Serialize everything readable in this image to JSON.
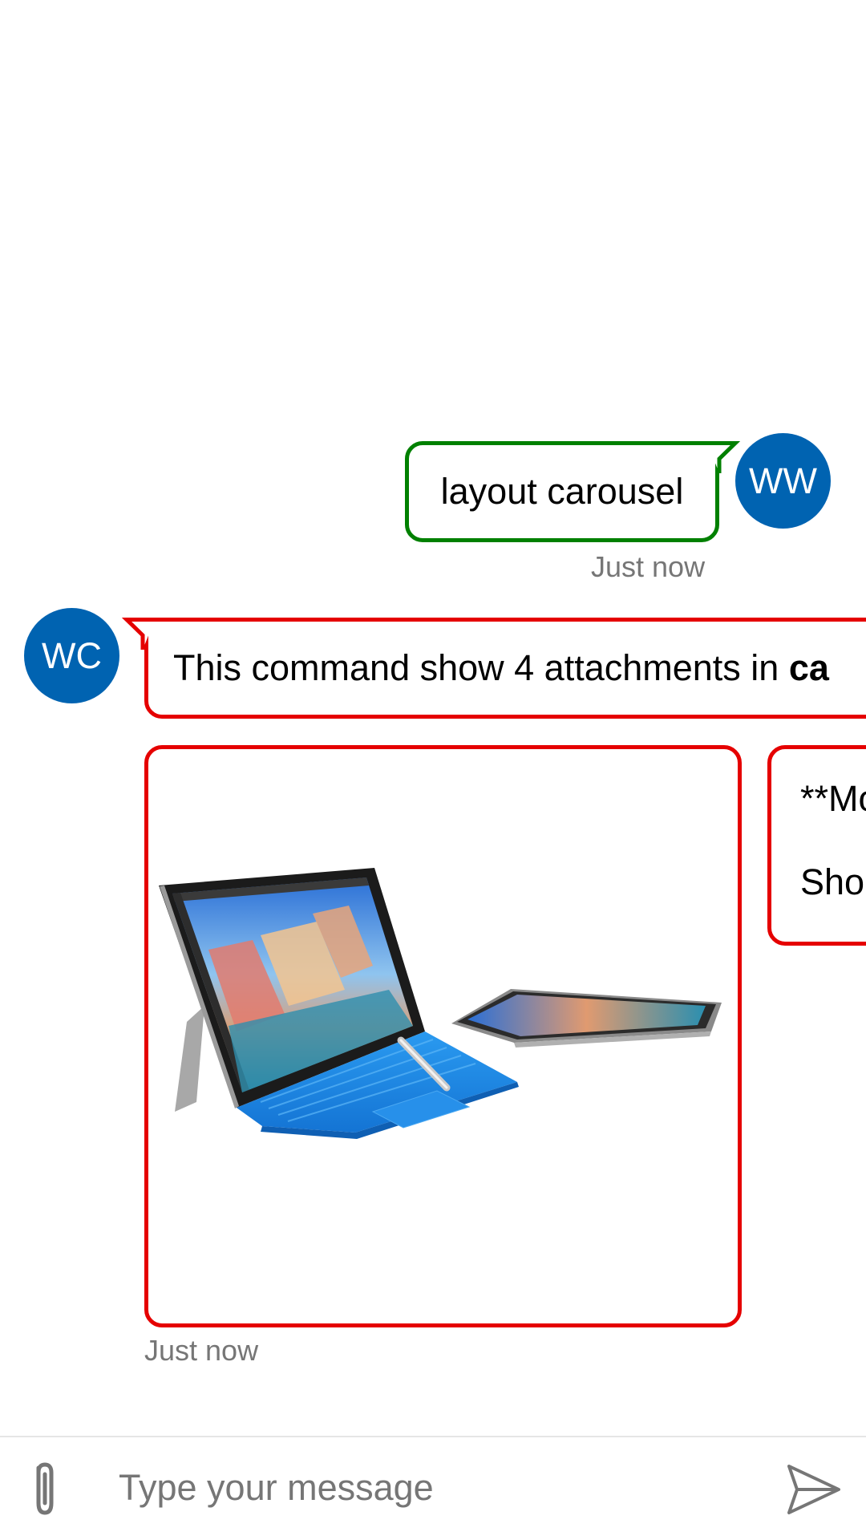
{
  "transcript": {
    "user_message": {
      "avatar_initials": "WW",
      "text": "layout carousel",
      "timestamp": "Just now",
      "border_color": "#008000"
    },
    "bot_message": {
      "avatar_initials": "WC",
      "text_prefix": "This command show 4 attachments in ",
      "text_bold": "ca",
      "timestamp": "Just now",
      "border_color": "#e50000",
      "carousel": {
        "image_card": {
          "image": "surface-pro-4-tablet-image"
        },
        "markdown_card": {
          "line1": "**Mo",
          "line2": "Sho"
        }
      }
    }
  },
  "sendbox": {
    "placeholder": "Type your message",
    "attach_icon": "paperclip-icon",
    "send_icon": "send-icon"
  },
  "colors": {
    "avatar_bg": "#0063b1",
    "user_border": "#008000",
    "bot_border": "#e50000",
    "timestamp": "#767676"
  }
}
